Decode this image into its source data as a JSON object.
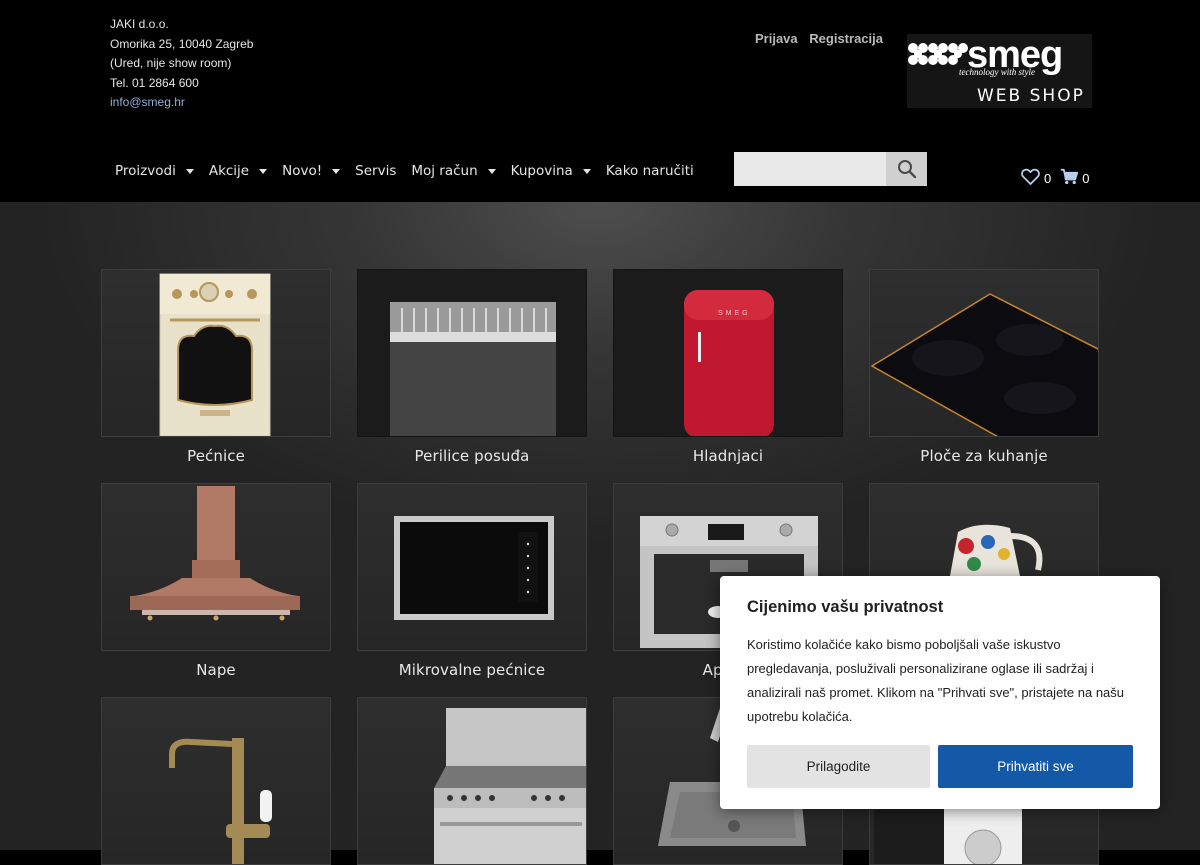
{
  "contact": {
    "company": "JAKI d.o.o.",
    "address": "Omorika 25, 10040 Zagreb",
    "note": "(Ured, nije show room)",
    "phone": "Tel. 01 2864 600",
    "email": "info@smeg.hr"
  },
  "auth": {
    "login": "Prijava",
    "register": "Registracija"
  },
  "logo": {
    "brand": "smeg",
    "tagline": "technology with style",
    "subtitle": "WEB SHOP"
  },
  "nav": {
    "items": [
      {
        "label": "Proizvodi",
        "dropdown": true
      },
      {
        "label": "Akcije",
        "dropdown": true
      },
      {
        "label": "Novo!",
        "dropdown": true
      },
      {
        "label": "Servis",
        "dropdown": false
      },
      {
        "label": "Moj račun",
        "dropdown": true
      },
      {
        "label": "Kupovina",
        "dropdown": true
      },
      {
        "label": "Kako naručiti",
        "dropdown": false
      }
    ]
  },
  "search": {
    "value": "",
    "placeholder": "",
    "icon": "search-icon"
  },
  "header_icons": {
    "wishlist_count": "0",
    "cart_count": "0"
  },
  "categories": [
    {
      "label": "Pećnice",
      "icon": "oven-image"
    },
    {
      "label": "Perilice posuđa",
      "icon": "dishwasher-image"
    },
    {
      "label": "Hladnjaci",
      "icon": "refrigerator-image"
    },
    {
      "label": "Ploče za kuhanje",
      "icon": "hob-image"
    },
    {
      "label": "Nape",
      "icon": "hood-image"
    },
    {
      "label": "Mikrovalne pećnice",
      "icon": "microwave-image"
    },
    {
      "label": "Aparat",
      "icon": "coffee-machine-image"
    },
    {
      "label": "",
      "icon": "kettle-image"
    },
    {
      "label": "",
      "icon": "faucet-image"
    },
    {
      "label": "",
      "icon": "range-cooker-image"
    },
    {
      "label": "",
      "icon": "sink-image"
    },
    {
      "label": "",
      "icon": "washing-machine-image"
    }
  ],
  "cookie": {
    "title": "Cijenimo vašu privatnost",
    "text": "Koristimo kolačiće kako bismo poboljšali vaše iskustvo pregledavanja, posluživali personalizirane oglase ili sadržaj i analizirali naš promet. Klikom na \"Prihvati sve\", pristajete na našu upotrebu kolačića.",
    "customize": "Prilagodite",
    "accept": "Prihvatiti sve"
  },
  "colors": {
    "accent": "#1458a8",
    "link": "#8fb0d8",
    "background": "#000000"
  }
}
